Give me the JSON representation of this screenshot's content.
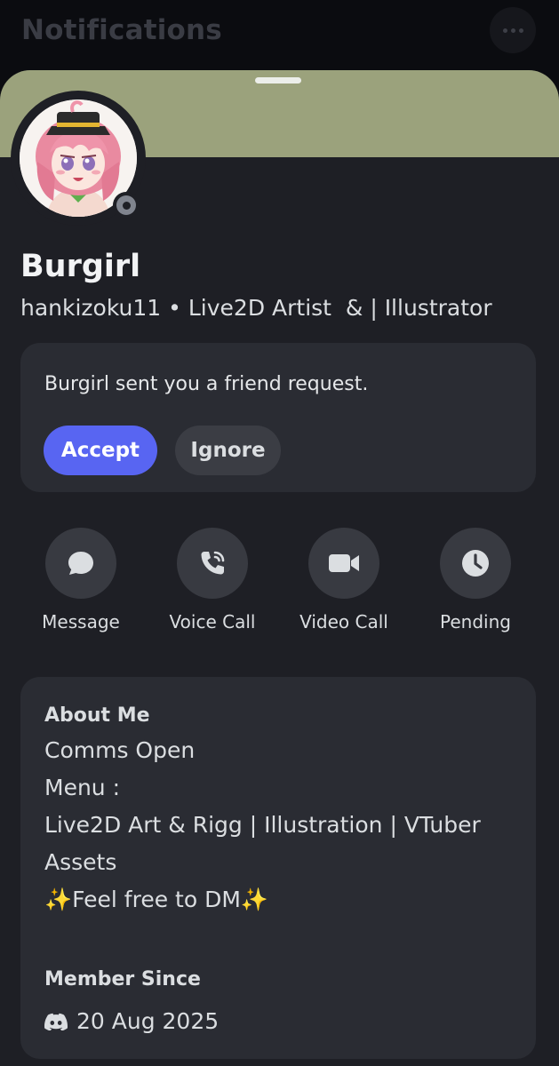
{
  "header": {
    "title": "Notifications"
  },
  "profile": {
    "display_name": "Burgirl",
    "username": "hankizoku11",
    "separator": "•",
    "tagline": "Live2D Artist  & | Illustrator",
    "banner_color": "#9ba27c",
    "status": "offline"
  },
  "friend_request": {
    "text": "Burgirl sent you a friend request.",
    "accept_label": "Accept",
    "ignore_label": "Ignore"
  },
  "actions": [
    {
      "label": "Message",
      "icon": "chat-bubble-icon"
    },
    {
      "label": "Voice Call",
      "icon": "phone-call-icon"
    },
    {
      "label": "Video Call",
      "icon": "video-camera-icon"
    },
    {
      "label": "Pending",
      "icon": "clock-icon"
    }
  ],
  "about": {
    "title": "About Me",
    "lines": [
      "Comms Open",
      "Menu :",
      "Live2D Art & Rigg | Illustration | VTuber",
      "Assets",
      "✨Feel free to DM✨"
    ]
  },
  "member_since": {
    "title": "Member Since",
    "date": "20 Aug 2025",
    "icon": "discord-logo-icon"
  },
  "colors": {
    "accent": "#5865f2",
    "background": "#1e1f25",
    "card": "#2a2c33"
  }
}
